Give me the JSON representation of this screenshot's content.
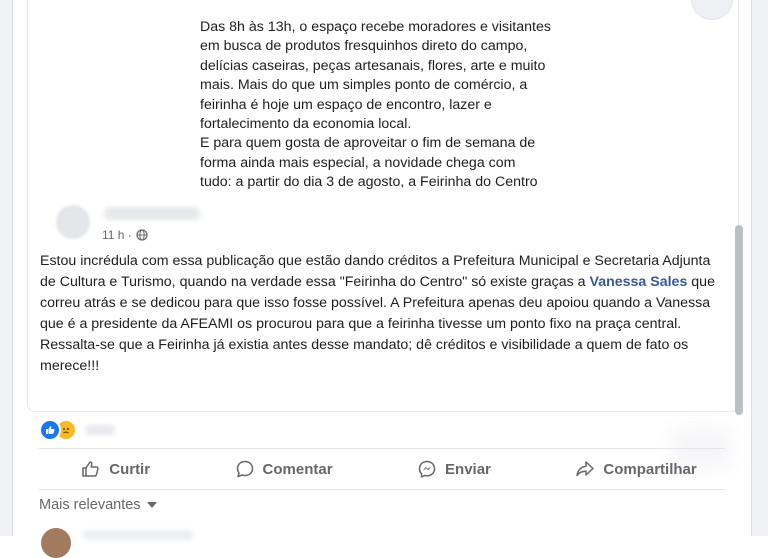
{
  "shared_post": {
    "text": "Das 8h às 13h, o espaço recebe moradores e visitantes\nem busca de produtos fresquinhos direto do campo,\ndelícias caseiras, peças artesanais, flores, arte e muito\nmais. Mais do que um simples ponto de comércio, a\nfeirinha é hoje um espaço de encontro, lazer e\nfortalecimento da economia local.\nE para quem gosta de aproveitar o fim de semana de\nforma ainda mais especial, a novidade chega com\ntudo: a partir do dia 3 de agosto, a Feirinha do Centro"
  },
  "post": {
    "timestamp": "11 h ·",
    "text_part1": "Estou incrédula com essa publicação que estão dando créditos a Prefeitura Municipal e Secretaria Adjunta de Cultura e Turismo, quando na verdade essa \"Feirinha do Centro\" só existe graças a ",
    "mention": "Vanessa Sales",
    "text_part2": " que correu atrás e se dedicou para que isso fosse possível. A Prefeitura apenas deu apoiou quando a Vanessa que é a presidente da AFEAMI os procurou para que  a feirinha tivesse um ponto fixo na praça central.",
    "text_part3": "Ressalta-se que a Feirinha já existia antes desse mandato; dê créditos e visibilidade a quem de fato os merece!!!"
  },
  "reactions": {
    "icons": [
      "like-icon",
      "sad-icon"
    ]
  },
  "actions": {
    "like_label": "Curtir",
    "comment_label": "Comentar",
    "send_label": "Enviar",
    "share_label": "Compartilhar"
  },
  "comments": {
    "sort_label": "Mais relevantes"
  },
  "colors": {
    "mention": "#385898",
    "like_blue": "#1877f2",
    "secondary_text": "#65676b"
  }
}
